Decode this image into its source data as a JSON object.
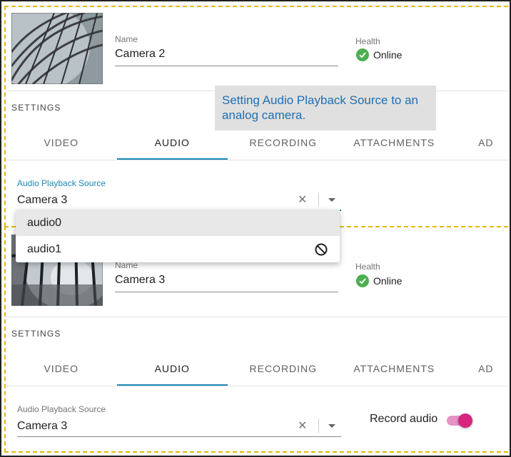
{
  "annotation": {
    "text": "Setting Audio Playback Source to an analog camera."
  },
  "camera_top": {
    "name_label": "Name",
    "name_value": "Camera 2",
    "health_label": "Health",
    "health_value": "Online",
    "settings_title": "SETTINGS",
    "tabs": [
      {
        "label": "VIDEO",
        "active": false
      },
      {
        "label": "AUDIO",
        "active": true
      },
      {
        "label": "RECORDING",
        "active": false
      },
      {
        "label": "ATTACHMENTS",
        "active": false
      },
      {
        "label": "AD",
        "active": false
      }
    ],
    "audio_source_label": "Audio Playback Source",
    "audio_source_value": "Camera 3",
    "dropdown_options": [
      {
        "label": "audio0",
        "highlighted": true,
        "disabled": false
      },
      {
        "label": "audio1",
        "highlighted": false,
        "disabled": true
      }
    ]
  },
  "camera_bottom": {
    "name_label": "Name",
    "name_value": "Camera 3",
    "health_label": "Health",
    "health_value": "Online",
    "settings_title": "SETTINGS",
    "tabs": [
      {
        "label": "VIDEO",
        "active": false
      },
      {
        "label": "AUDIO",
        "active": true
      },
      {
        "label": "RECORDING",
        "active": false
      },
      {
        "label": "ATTACHMENTS",
        "active": false
      },
      {
        "label": "AD",
        "active": false
      }
    ],
    "audio_source_label": "Audio Playback Source",
    "audio_source_value": "Camera 3",
    "record_audio_label": "Record audio",
    "record_audio_on": true
  },
  "icons": {
    "clear": "close-icon",
    "caret": "arrow-drop-down-icon",
    "health": "check-circle-icon",
    "disabled_option": "block-icon"
  },
  "colors": {
    "accent": "#1e88b8",
    "online_green": "#4caf50",
    "annotation_text": "#1e6fb5",
    "annotation_bg": "#e0e0e0",
    "toggle_on": "#d8237f",
    "dashed_border": "#e6b800"
  }
}
